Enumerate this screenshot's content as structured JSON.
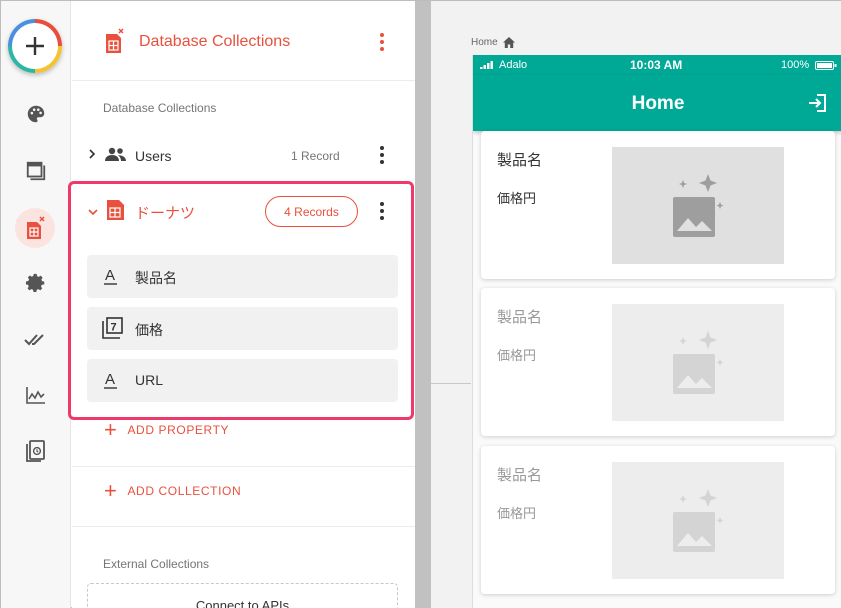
{
  "panel": {
    "title": "Database Collections",
    "section_label": "Database Collections",
    "external_label": "External Collections",
    "add_property": "ADD PROPERTY",
    "add_collection": "ADD COLLECTION",
    "connect_apis": "Connect to APIs"
  },
  "collections": [
    {
      "name": "Users",
      "count": "1 Record",
      "expanded": false
    },
    {
      "name": "ドーナツ",
      "count": "4 Records",
      "expanded": true
    }
  ],
  "properties": [
    {
      "name": "製品名",
      "type_icon": "text-type-icon"
    },
    {
      "name": "価格",
      "type_icon": "number-type-icon"
    },
    {
      "name": "URL",
      "type_icon": "text-type-icon"
    }
  ],
  "canvas": {
    "breadcrumb": "Home",
    "status_carrier": "Adalo",
    "status_time": "10:03 AM",
    "status_battery": "100%",
    "screen_title": "Home",
    "cards": [
      {
        "name": "製品名",
        "price": "価格円"
      },
      {
        "name": "製品名",
        "price": "価格円"
      },
      {
        "name": "製品名",
        "price": "価格円"
      }
    ]
  },
  "colors": {
    "accent": "#e9503d",
    "teal": "#00a896",
    "highlight": "#f0396b"
  }
}
